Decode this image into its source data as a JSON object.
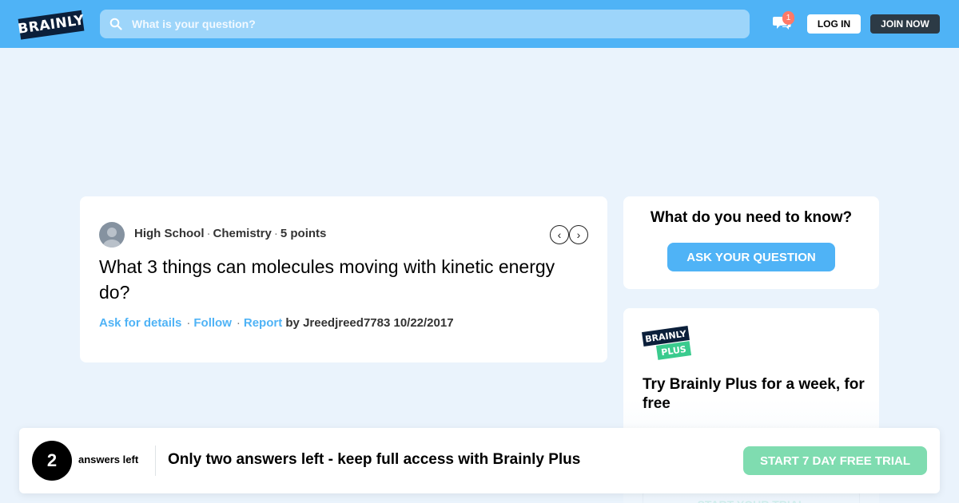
{
  "header": {
    "logo_text": "BRAINLY",
    "search_placeholder": "What is your question?",
    "notification_count": "1",
    "login_label": "LOG IN",
    "join_label": "JOIN NOW"
  },
  "question": {
    "level": "High School",
    "subject": "Chemistry",
    "points": "5 points",
    "text": "What 3 things can molecules moving with kinetic energy do?",
    "actions": {
      "ask_details": "Ask for details",
      "follow": "Follow",
      "report": "Report"
    },
    "author_line": "by Jreedjreed7783 10/22/2017"
  },
  "ask_card": {
    "title": "What do you need to know?",
    "button": "ASK YOUR QUESTION"
  },
  "plus_card": {
    "logo_top": "BRAINLY",
    "logo_bottom": "PLUS",
    "title": "Try Brainly Plus for a week, for free",
    "button": "START YOUR TRIAL"
  },
  "banner": {
    "count": "2",
    "count_label": "answers left",
    "message": "Only two answers left - keep full access with Brainly Plus",
    "button": "START 7 DAY FREE TRIAL"
  },
  "colors": {
    "header_blue": "#4fb3f6",
    "background": "#eaf3fc",
    "plus_green": "#3acb8e",
    "dark_button": "#2c3a45"
  }
}
